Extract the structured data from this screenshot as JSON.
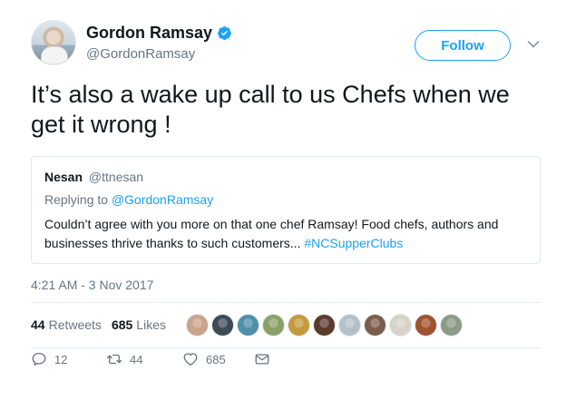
{
  "author": {
    "name": "Gordon Ramsay",
    "handle": "@GordonRamsay",
    "verified": true
  },
  "follow_label": "Follow",
  "tweet_text": "It’s also a wake up call to us Chefs when we get it wrong !",
  "quoted": {
    "name": "Nesan",
    "handle": "@ttnesan",
    "replying_prefix": "Replying to",
    "replying_to": "@GordonRamsay",
    "body": "Couldn’t agree with you more on that one chef Ramsay! Food chefs, authors and businesses thrive thanks to such customers...",
    "hashtag": "#NCSupperClubs"
  },
  "timestamp": "4:21 AM - 3 Nov 2017",
  "stats": {
    "retweets_count": "44",
    "retweets_label": "Retweets",
    "likes_count": "685",
    "likes_label": "Likes"
  },
  "liker_faces": [
    {
      "color": "#caa38a"
    },
    {
      "color": "#3f4a55"
    },
    {
      "color": "#4d8fa7"
    },
    {
      "color": "#8aa06a"
    },
    {
      "color": "#c49a3c"
    },
    {
      "color": "#5a3b2c"
    },
    {
      "color": "#b5bfc7"
    },
    {
      "color": "#7a5d4a"
    },
    {
      "color": "#d8d2c8"
    },
    {
      "color": "#a0522d"
    },
    {
      "color": "#8c9a86"
    }
  ],
  "actions": {
    "reply_count": "12",
    "retweet_count": "44",
    "like_count": "685"
  },
  "colors": {
    "accent": "#1da1f2",
    "muted": "#657786",
    "border": "#e1e8ed"
  }
}
